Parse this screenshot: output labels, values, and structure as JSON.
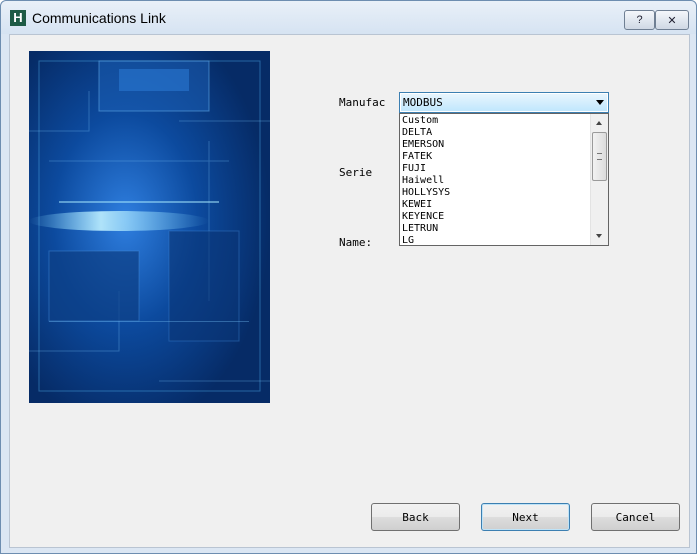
{
  "window": {
    "title": "Communications Link",
    "app_icon": "H",
    "help_glyph": "?",
    "close_glyph": "✕"
  },
  "form": {
    "manufacturer_label": "Manufac",
    "series_label": "Serie",
    "name_label": "Name:",
    "manufacturer_value": "MODBUS",
    "manufacturer_options": [
      "Custom",
      "DELTA",
      "EMERSON",
      "FATEK",
      "FUJI",
      "Haiwell",
      "HOLLYSYS",
      "KEWEI",
      "KEYENCE",
      "LETRUN",
      "LG"
    ]
  },
  "buttons": {
    "back": "Back",
    "next": "Next",
    "cancel": "Cancel"
  },
  "colors": {
    "banner": "#0b3c82",
    "accent": "#3c7fb1"
  }
}
